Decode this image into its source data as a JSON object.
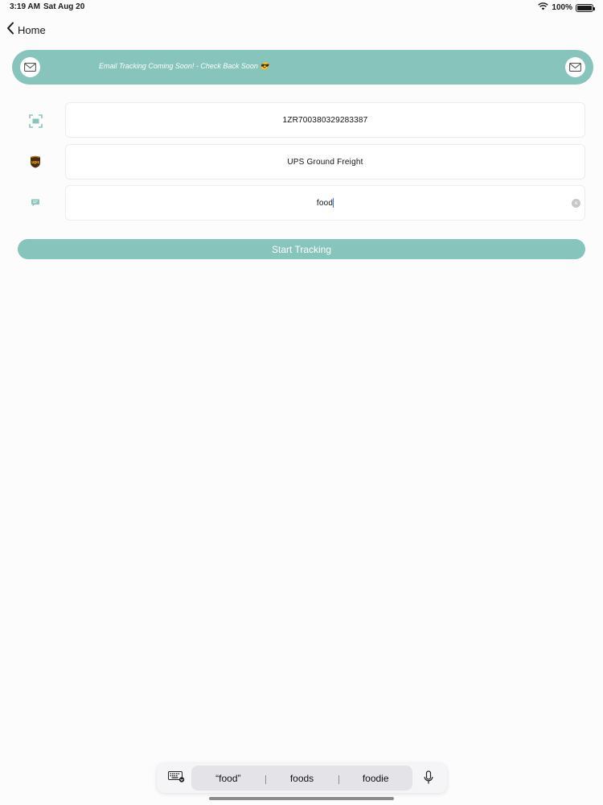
{
  "status_bar": {
    "time": "3:19 AM",
    "date": "Sat Aug 20",
    "wifi_icon": "wifi-icon",
    "battery_text": "100%",
    "battery_level": 1.0
  },
  "nav": {
    "back_label": "Home",
    "back_icon": "chevron-left-icon"
  },
  "banner": {
    "text": "Email Tracking Coming Soon! - Check Back Soon 😎",
    "left_icon": "envelope-icon",
    "right_icon": "envelope-icon",
    "color": "#87c4bb"
  },
  "form": {
    "tracking_number": {
      "icon": "barcode-scan-icon",
      "value": "1ZR700380329283387"
    },
    "carrier": {
      "icon": "ups-logo-icon",
      "value": "UPS Ground Freight"
    },
    "description": {
      "icon": "chat-bubble-icon",
      "value": "food",
      "clear_icon": "clear-icon"
    },
    "submit_label": "Start Tracking"
  },
  "keyboard": {
    "keyboard_icon": "keyboard-icon",
    "suggestions": [
      "“food”",
      "foods",
      "foodie"
    ],
    "mic_icon": "microphone-icon"
  },
  "colors": {
    "accent": "#87c4bb",
    "background": "#fdfcfd",
    "ups_brown": "#4b2a12",
    "ups_gold": "#f6b300"
  }
}
